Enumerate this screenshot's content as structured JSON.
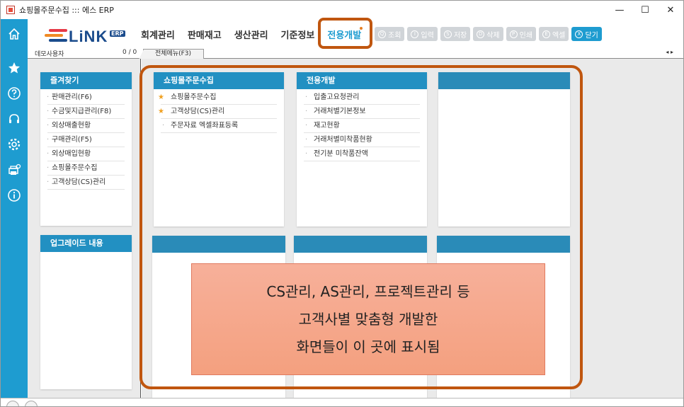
{
  "window": {
    "title": "쇼핑몰주문수집 ::: 에스 ERP",
    "controls": {
      "minimize": "—",
      "maximize": "☐",
      "close": "✕"
    }
  },
  "sidebar": {
    "icons": [
      "home-icon",
      "star-icon",
      "help-icon",
      "headset-icon",
      "settings-icon",
      "printer-settings-icon",
      "info-icon"
    ]
  },
  "logo": {
    "text": "LiNK",
    "badge": "ERP"
  },
  "nav": {
    "items": [
      {
        "label": "회계관리"
      },
      {
        "label": "판매재고"
      },
      {
        "label": "생산관리"
      },
      {
        "label": "기준정보"
      },
      {
        "label": "전용개발",
        "active": true
      }
    ]
  },
  "toolbar": {
    "buttons": [
      {
        "icon": "Q",
        "label": "조회"
      },
      {
        "icon": "I",
        "label": "입력"
      },
      {
        "icon": "S",
        "label": "저장"
      },
      {
        "icon": "D",
        "label": "삭제"
      },
      {
        "icon": "P",
        "label": "인쇄"
      },
      {
        "icon": "E",
        "label": "엑셀"
      },
      {
        "icon": "X",
        "label": "닫기"
      }
    ]
  },
  "subheader": {
    "user_label": "데모사용자",
    "user_count": "0 / 0",
    "tab_label": "전체메뉴(F3)",
    "scroll_arrows": "◂ ▸"
  },
  "favorites": {
    "title": "즐겨찾기",
    "items": [
      "판매관리(F6)",
      "수금및지급관리(F8)",
      "외상매출현황",
      "구매관리(F5)",
      "외상매입현황",
      "쇼핑몰주문수집",
      "고객상담(CS)관리"
    ]
  },
  "upgrade": {
    "title": "업그레이드 내용"
  },
  "module_shopping": {
    "title": "쇼핑몰주문수집",
    "items": [
      {
        "label": "쇼핑몰주문수집",
        "starred": true
      },
      {
        "label": "고객상담(CS)관리",
        "starred": true
      },
      {
        "label": "주문자료 엑셀좌표등록",
        "starred": false
      }
    ]
  },
  "module_custom": {
    "title": "전용개발",
    "items": [
      "입출고요청관리",
      "거래처별기본정보",
      "재고현황",
      "거래처별미착품현황",
      "전기분 미착품잔액"
    ]
  },
  "overlay": {
    "lines": [
      "CS관리, AS관리, 프로젝트관리 등",
      "고객사별 맞춤형 개발한",
      "화면들이 이 곳에 표시됨"
    ]
  },
  "colors": {
    "sidebar": "#1e9cd0",
    "card_header": "#2290c2",
    "highlight": "#c0560f",
    "overlay": "#f4a07f",
    "toolbar_disabled": "#d0d4d8"
  }
}
